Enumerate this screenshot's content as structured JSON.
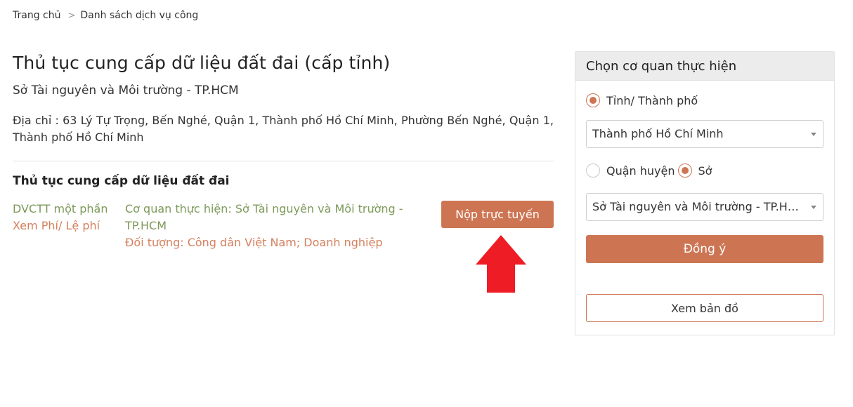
{
  "breadcrumb": {
    "home": "Trang chủ",
    "separator": ">",
    "current": "Danh sách dịch vụ công"
  },
  "main": {
    "title": "Thủ tục cung cấp dữ liệu đất đai (cấp tỉnh)",
    "agency": "Sở Tài nguyên và Môi trường - TP.HCM",
    "address": "Địa chỉ : 63 Lý Tự Trọng, Bến Nghé, Quận 1, Thành phố Hồ Chí Minh, Phường Bến Nghé, Quận 1, Thành phố Hồ Chí Minh",
    "section_title": "Thủ tục cung cấp dữ liệu đất đai",
    "procedure": {
      "type": "DVCTT một phần",
      "fee_link": "Xem Phí/ Lệ phí",
      "agency": "Cơ quan thực hiện: Sở Tài nguyên và Môi trường - TP.HCM",
      "target": "Đối tượng: Công dân Việt Nam; Doanh nghiệp",
      "submit_label": "Nộp trực tuyến"
    },
    "annotation_arrow_color": "#ee1c25"
  },
  "panel": {
    "header": "Chọn cơ quan thực hiện",
    "radio_province": "Tỉnh/ Thành phố",
    "province_select": "Thành phố Hồ Chí Minh",
    "radio_district": "Quận huyện",
    "radio_department": "Sở",
    "department_select": "Sở Tài nguyên và Môi trường - TP.HCM",
    "agree_label": "Đồng ý",
    "map_label": "Xem bản đồ"
  },
  "colors": {
    "accent": "#cd7553",
    "green_text": "#7d9a5a",
    "orange_text": "#d4805e"
  }
}
